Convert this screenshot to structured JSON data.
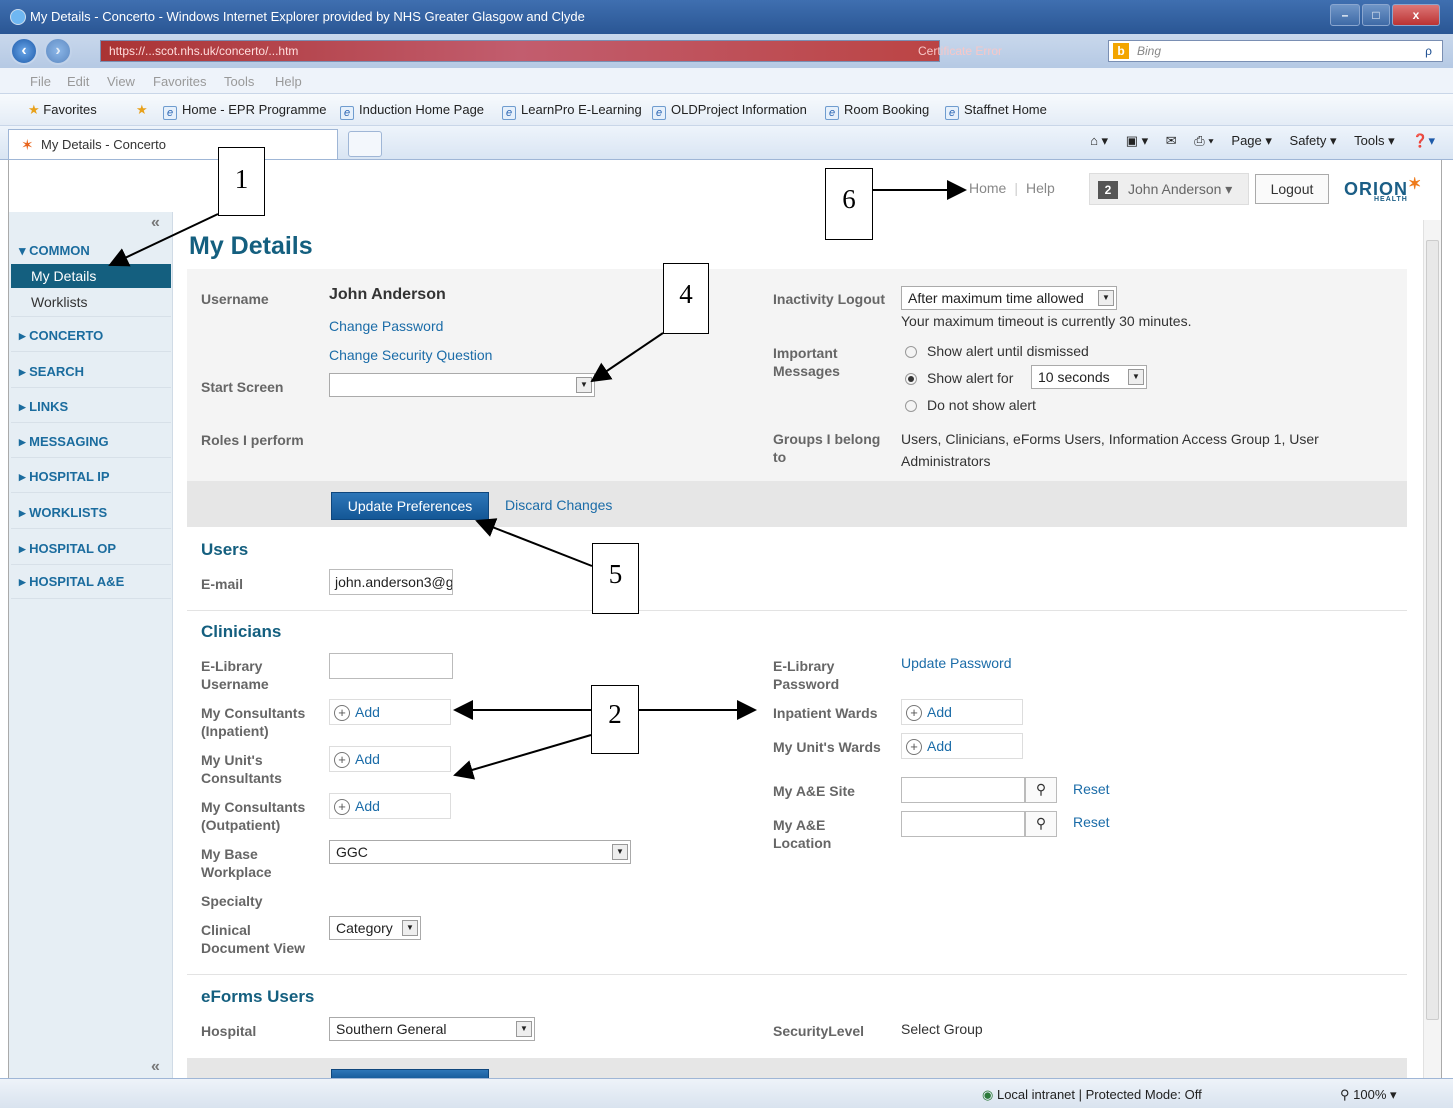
{
  "window": {
    "title": "My Details - Concerto - Windows Internet Explorer provided by NHS Greater Glasgow and Clyde",
    "min": "–",
    "max": "□",
    "close": "x"
  },
  "address": {
    "url": "https://...scot.nhs.uk/concerto/...htm",
    "cert": "Certificate Error",
    "search_placeholder": "Bing",
    "search_go": "ρ"
  },
  "menu": [
    "File",
    "Edit",
    "View",
    "Favorites",
    "Tools",
    "Help"
  ],
  "favorites": {
    "label": "Favorites",
    "links": [
      "Home - EPR Programme",
      "Induction Home Page",
      "LearnPro E-Learning",
      "OLDProject Information",
      "Room Booking",
      "Staffnet Home"
    ]
  },
  "tab": {
    "title": "My Details - Concerto"
  },
  "commandbar": {
    "page": "Page ▾",
    "safety": "Safety ▾",
    "tools": "Tools ▾"
  },
  "header": {
    "home": "Home",
    "help": "Help",
    "badge": "2",
    "user": "John Anderson ▾",
    "logout": "Logout",
    "logo": "ORION",
    "logo_sub": "HEALTH"
  },
  "sidebar": {
    "collapse": "«",
    "sections": [
      {
        "label": "▾ COMMON",
        "items": [
          "My Details",
          "Worklists"
        ]
      },
      {
        "label": "▸ CONCERTO"
      },
      {
        "label": "▸ SEARCH"
      },
      {
        "label": "▸ LINKS"
      },
      {
        "label": "▸ MESSAGING"
      },
      {
        "label": "▸ HOSPITAL IP"
      },
      {
        "label": "▸ WORKLISTS"
      },
      {
        "label": "▸ HOSPITAL OP"
      },
      {
        "label": "▸ HOSPITAL A&E"
      }
    ]
  },
  "main": {
    "title": "My Details",
    "username_label": "Username",
    "username_value": "John Anderson",
    "change_password": "Change Password",
    "change_security": "Change Security Question",
    "start_screen_label": "Start Screen",
    "start_screen_value": "",
    "roles_label": "Roles I perform",
    "inactivity_label": "Inactivity Logout",
    "inactivity_value": "After maximum time allowed",
    "timeout_note": "Your maximum timeout is currently 30 minutes.",
    "important_label": "Important Messages",
    "radio1": "Show alert until dismissed",
    "radio2": "Show alert for",
    "radio2_value": "10 seconds",
    "radio3": "Do not show alert",
    "groups_label": "Groups I belong to",
    "groups_value": "Users, Clinicians, eForms Users, Information Access Group 1, User Administrators",
    "update_btn": "Update Preferences",
    "discard": "Discard Changes",
    "users_heading": "Users",
    "email_label": "E-mail",
    "email_value": "john.anderson3@g",
    "clinicians_heading": "Clinicians",
    "elib_user_label": "E-Library Username",
    "elib_pw_label": "E-Library Password",
    "update_password": "Update Password",
    "cons_inp_label": "My Consultants (Inpatient)",
    "unit_cons_label": "My Unit's Consultants",
    "cons_out_label": "My Consultants (Outpatient)",
    "add": "Add",
    "inpatient_wards_label": "Inpatient Wards",
    "unit_wards_label": "My Unit's Wards",
    "ae_site_label": "My A&E Site",
    "ae_loc_label": "My A&E Location",
    "reset": "Reset",
    "base_label": "My Base Workplace",
    "base_value": "GGC",
    "specialty_label": "Specialty",
    "cdv_label": "Clinical Document View",
    "cdv_value": "Category",
    "eforms_heading": "eForms Users",
    "hospital_label": "Hospital",
    "hospital_value": "Southern General",
    "security_label": "SecurityLevel",
    "security_value": "Select Group"
  },
  "callouts": [
    "1",
    "2",
    "4",
    "5",
    "6"
  ],
  "status": {
    "zone": "Local intranet | Protected Mode: Off",
    "zoom": "100%"
  }
}
